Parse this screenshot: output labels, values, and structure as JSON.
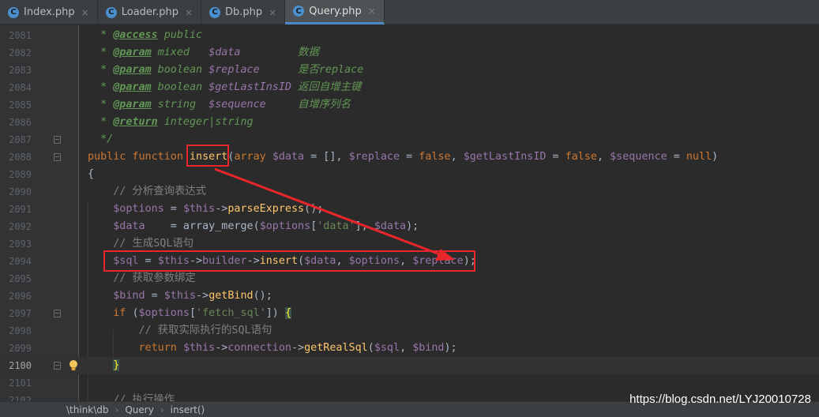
{
  "tabs": [
    {
      "label": "Index.php",
      "icon": "php-class-icon",
      "active": false
    },
    {
      "label": "Loader.php",
      "icon": "php-class-icon",
      "active": false
    },
    {
      "label": "Db.php",
      "icon": "php-class-icon",
      "active": false
    },
    {
      "label": "Query.php",
      "icon": "php-class-icon",
      "active": true
    }
  ],
  "tab_icon_letter": "C",
  "tab_close_glyph": "×",
  "line_numbers": [
    "2081",
    "2082",
    "2083",
    "2084",
    "2085",
    "2086",
    "2087",
    "2088",
    "2089",
    "2090",
    "2091",
    "2092",
    "2093",
    "2094",
    "2095",
    "2096",
    "2097",
    "2098",
    "2099",
    "2100",
    "2101",
    "2102"
  ],
  "current_line": "2100",
  "breadcrumb": [
    "\\think\\db",
    "Query",
    "insert()"
  ],
  "watermark": "https://blog.csdn.net/LYJ20010728",
  "colors": {
    "accent": "#4a88c7",
    "annotation": "#e8262b",
    "background": "#2b2b2b"
  }
}
